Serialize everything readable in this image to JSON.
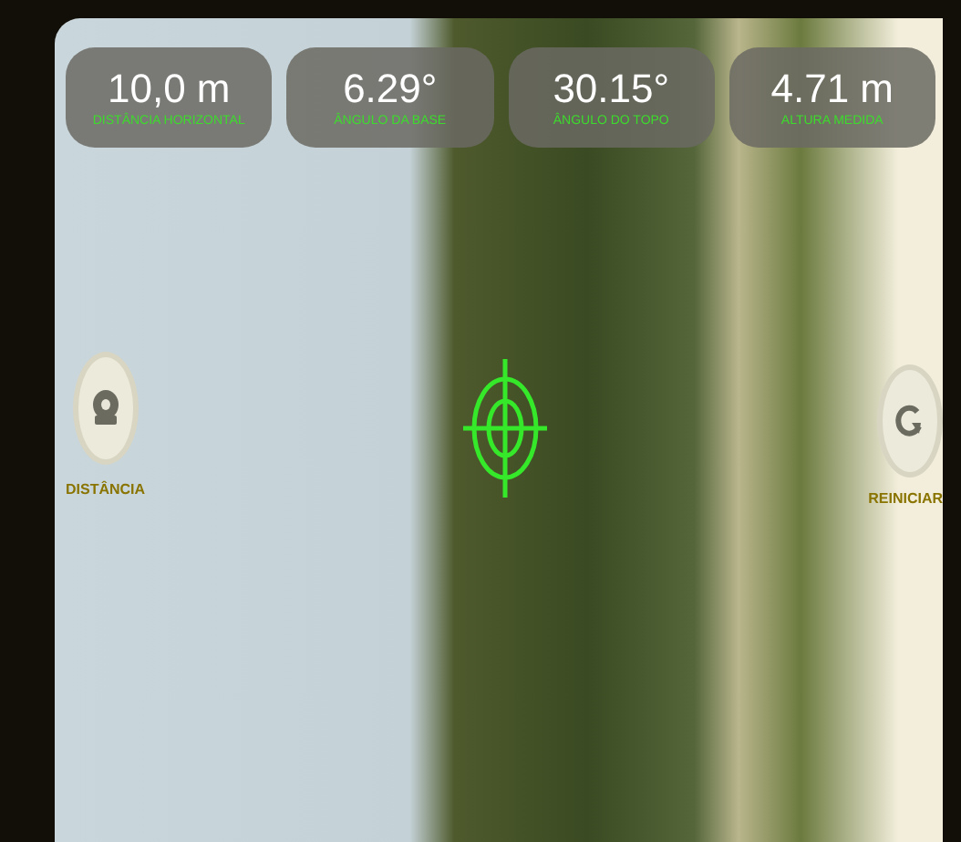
{
  "readouts": [
    {
      "value": "10,0 m",
      "label": "DISTÂNCIA HORIZONTAL"
    },
    {
      "value": "6.29°",
      "label": "ÂNGULO DA BASE"
    },
    {
      "value": "30.15°",
      "label": "ÂNGULO DO TOPO"
    },
    {
      "value": "4.71 m",
      "label": "ALTURA MEDIDA"
    }
  ],
  "side_buttons": [
    {
      "kind": "distance",
      "label": "DISTÂNCIA"
    },
    {
      "kind": "reset",
      "label": "REINICIAR"
    }
  ]
}
